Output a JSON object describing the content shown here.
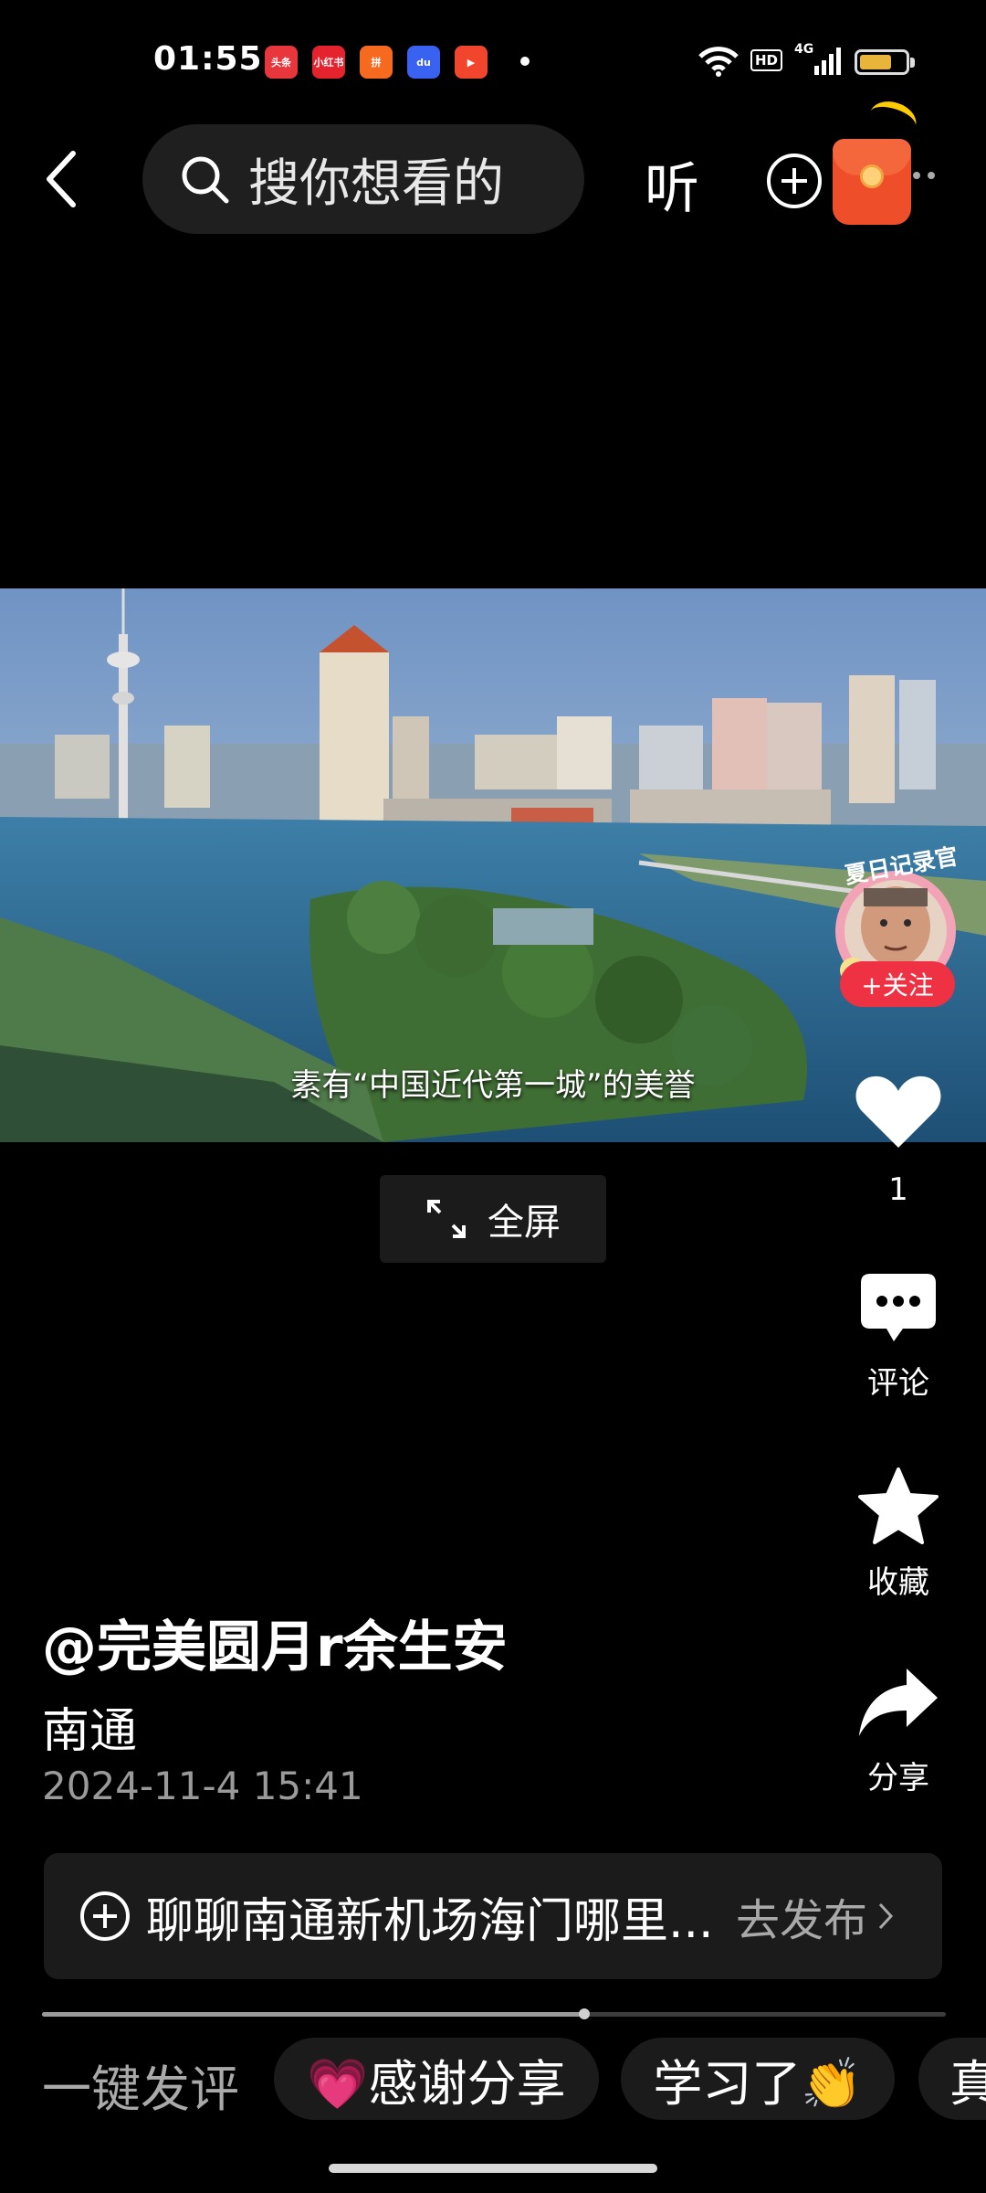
{
  "status_bar": {
    "time": "01:55",
    "notification_icons": [
      {
        "name": "toutiao-app-icon",
        "text": "头条",
        "color": "#e8373c"
      },
      {
        "name": "xiaohongshu-app-icon",
        "text": "小红书",
        "color": "#e5232f"
      },
      {
        "name": "pinduoduo-app-icon",
        "text": "拼",
        "color": "#f56a1e"
      },
      {
        "name": "baidu-app-icon",
        "text": "du",
        "color": "#3a62f0"
      },
      {
        "name": "video-app-icon",
        "text": "▶",
        "color": "#f1462d"
      }
    ],
    "hd_label": "HD",
    "network_label": "4G",
    "battery_percent": 70
  },
  "top_bar": {
    "search_placeholder": "搜你想看的",
    "listen_label": "听"
  },
  "video": {
    "subtitle": "素有“中国近代第一城”的美誉",
    "fullscreen_label": "全屏"
  },
  "creator_badge": {
    "badge_text": "夏日记录官",
    "follow_label": "+关注"
  },
  "actions": {
    "like_count": "1",
    "comment_label": "评论",
    "favorite_label": "收藏",
    "share_label": "分享"
  },
  "post": {
    "author": "@完美圆月r余生安",
    "location": "南通",
    "timestamp": "2024-11-4 15:41"
  },
  "topic_bar": {
    "text": "聊聊南通新机场海门哪里...",
    "action_label": "去发布"
  },
  "playback": {
    "progress": 0.6
  },
  "quick_comments": {
    "label": "一键发评",
    "chips": [
      "💗感谢分享",
      "学习了👏",
      "真"
    ]
  }
}
